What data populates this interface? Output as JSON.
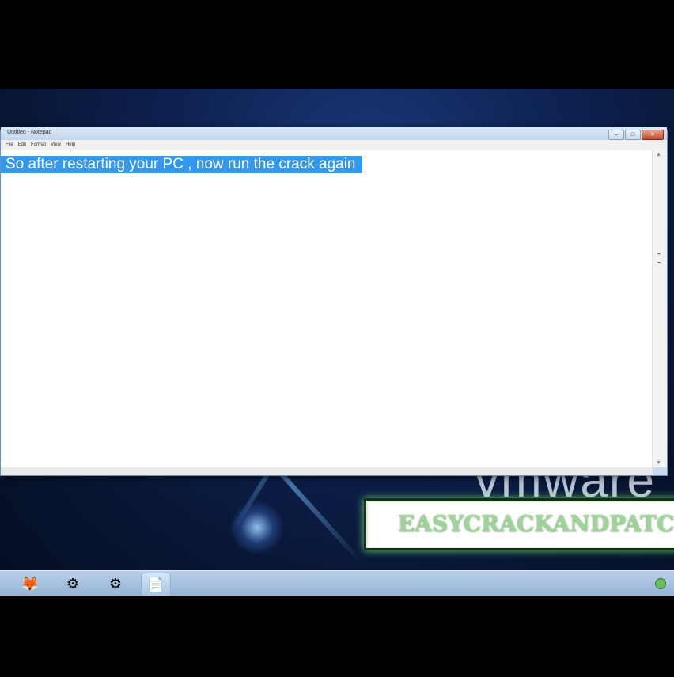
{
  "notepad": {
    "title": "Untitled - Notepad",
    "menu": [
      "File",
      "Edit",
      "Format",
      "View",
      "Help"
    ],
    "window_controls": {
      "minimize": "–",
      "maximize": "□",
      "close": "✕"
    },
    "selected_text": "So after restarting your PC , now run the crack again"
  },
  "desktop": {
    "vmware_logo": "vmware",
    "watermark": "EASYCRACKANDPATCH"
  },
  "taskbar": {
    "buttons": [
      {
        "name": "firefox",
        "glyph": "🦊"
      },
      {
        "name": "app-2",
        "glyph": "⚙"
      },
      {
        "name": "app-3",
        "glyph": "⚙"
      },
      {
        "name": "notepad",
        "glyph": "📄"
      }
    ],
    "tray_color": "#63c05a"
  },
  "colors": {
    "selection": "#3398f0",
    "desktop": "#0f2456"
  }
}
